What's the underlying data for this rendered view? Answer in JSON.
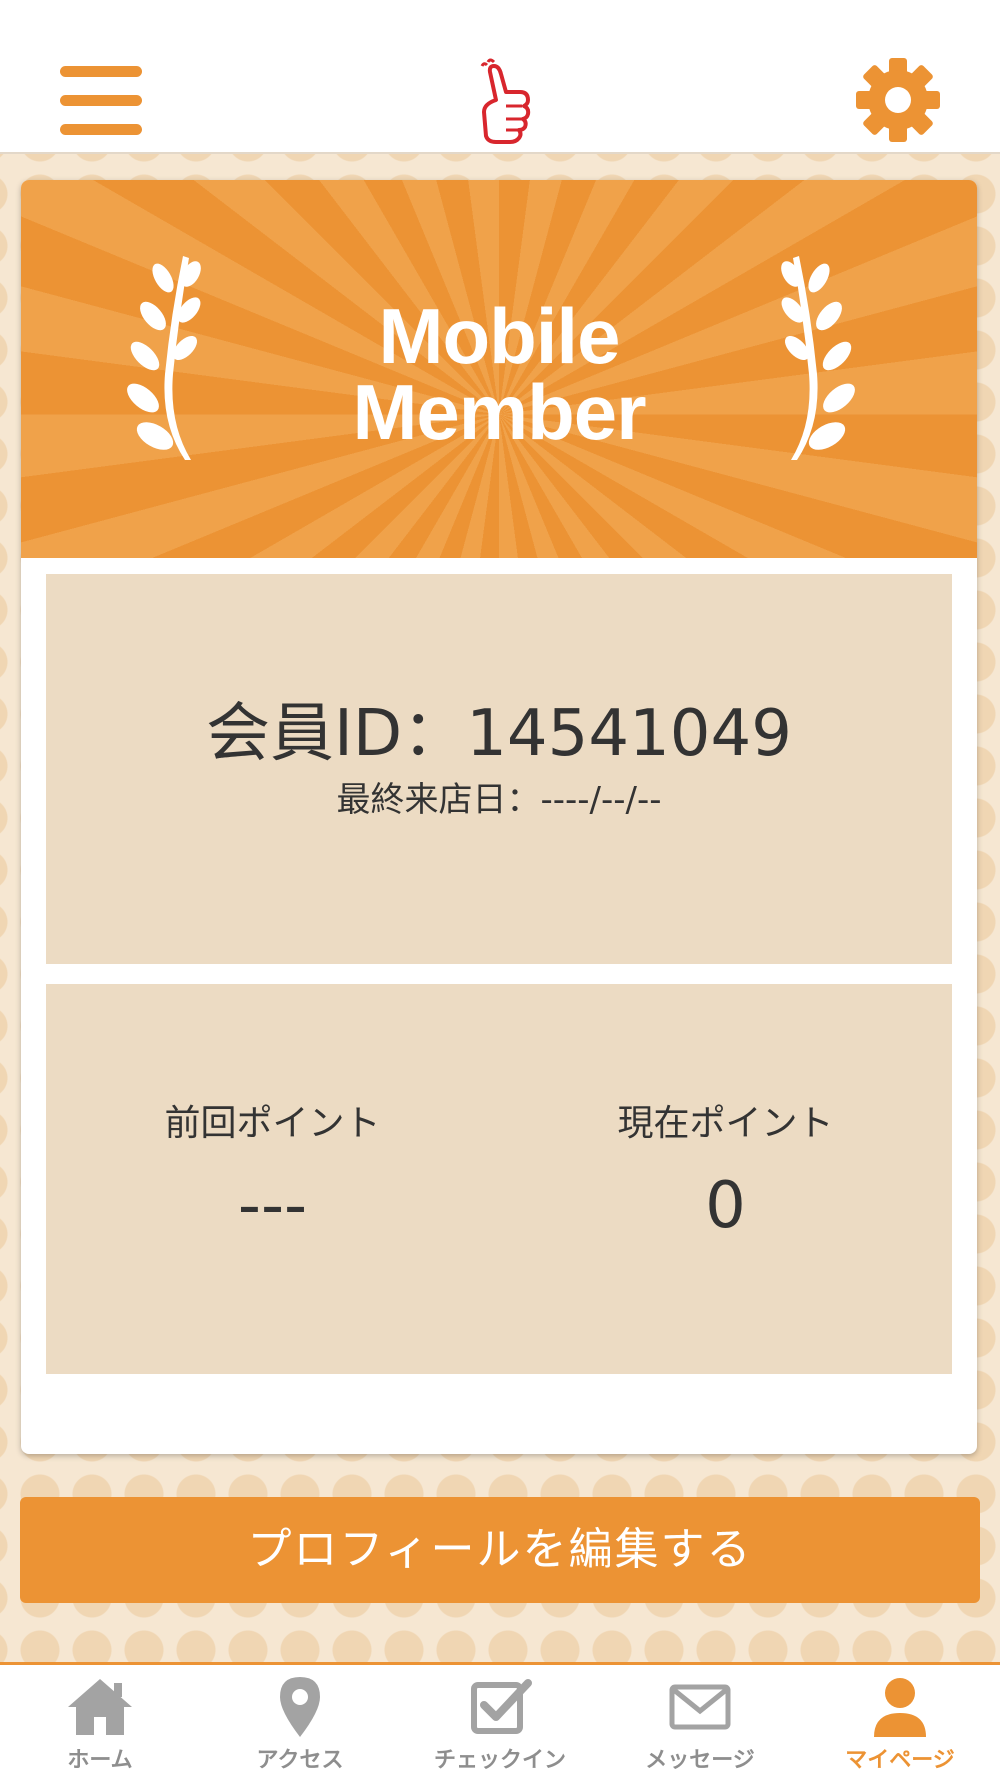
{
  "theme": {
    "accent": "#ec9334",
    "panel": "#ecdbc3",
    "inactive_tab": "#8e8e8e"
  },
  "header": {
    "menu_icon": "hamburger-menu-icon",
    "logo_icon": "thumbs-up-logo",
    "settings_icon": "gear-icon"
  },
  "banner": {
    "title_line1": "Mobile",
    "title_line2": "Member"
  },
  "member": {
    "id_text": "会員ID：14541049",
    "last_visit_text": "最終来店日：----/--/--"
  },
  "points": {
    "previous_label": "前回ポイント",
    "previous_value": "---",
    "current_label": "現在ポイント",
    "current_value": "0"
  },
  "edit_profile_label": "プロフィールを編集する",
  "tabs": [
    {
      "label": "ホーム",
      "icon": "home-icon",
      "active": false
    },
    {
      "label": "アクセス",
      "icon": "map-pin-icon",
      "active": false
    },
    {
      "label": "チェックイン",
      "icon": "checkbox-icon",
      "active": false
    },
    {
      "label": "メッセージ",
      "icon": "envelope-icon",
      "active": false
    },
    {
      "label": "マイページ",
      "icon": "user-icon",
      "active": true
    }
  ]
}
